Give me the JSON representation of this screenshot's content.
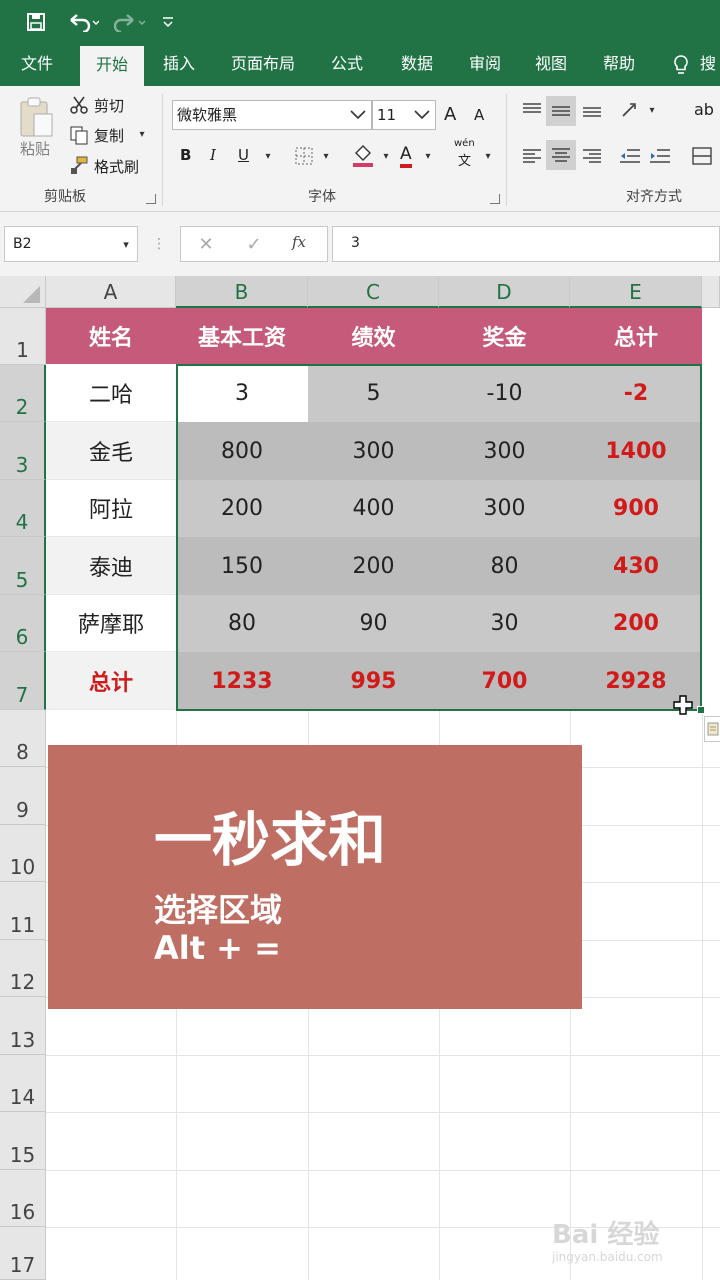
{
  "quick_access": {
    "save_icon": "save-icon",
    "undo_icon": "undo-icon",
    "redo_icon": "redo-icon",
    "customize_icon": "customize-qat-icon"
  },
  "ribbon_tabs": [
    "文件",
    "开始",
    "插入",
    "页面布局",
    "公式",
    "数据",
    "审阅",
    "视图",
    "帮助",
    "搜"
  ],
  "clipboard": {
    "paste": "粘贴",
    "cut": "剪切",
    "copy": "复制",
    "format_painter": "格式刷",
    "group_label": "剪贴板"
  },
  "font": {
    "name": "微软雅黑",
    "size": "11",
    "bold": "B",
    "italic": "I",
    "underline": "U",
    "font_color_letter": "A",
    "phonetic_top": "wén",
    "phonetic_bottom": "文",
    "grow": "A",
    "shrink": "A",
    "group_label": "字体"
  },
  "alignment": {
    "group_label": "对齐方式",
    "wrap_letters": "ab"
  },
  "formula_bar": {
    "name_box": "B2",
    "fx": "fx",
    "value": "3"
  },
  "grid": {
    "columns": [
      "A",
      "B",
      "C",
      "D",
      "E"
    ],
    "rows": [
      "1",
      "2",
      "3",
      "4",
      "5",
      "6",
      "7",
      "8",
      "9",
      "10",
      "11",
      "12",
      "13",
      "14",
      "15",
      "16",
      "17"
    ],
    "header": [
      "姓名",
      "基本工资",
      "绩效",
      "奖金",
      "总计"
    ],
    "data": [
      [
        "二哈",
        "3",
        "5",
        "-10",
        "-2"
      ],
      [
        "金毛",
        "800",
        "300",
        "300",
        "1400"
      ],
      [
        "阿拉",
        "200",
        "400",
        "300",
        "900"
      ],
      [
        "泰迪",
        "150",
        "200",
        "80",
        "430"
      ],
      [
        "萨摩耶",
        "80",
        "90",
        "30",
        "200"
      ],
      [
        "总计",
        "1233",
        "995",
        "700",
        "2928"
      ]
    ],
    "colors": {
      "header_bg": "#c55a7a",
      "total_red": "#d11a1a",
      "selection": "#217346"
    }
  },
  "overlay": {
    "title": "一秒求和",
    "line1": "选择区域",
    "line2": "Alt + =",
    "bg": "#bf6e63"
  },
  "watermark": {
    "brand": "Bai 经验",
    "url": "jingyan.baidu.com"
  }
}
